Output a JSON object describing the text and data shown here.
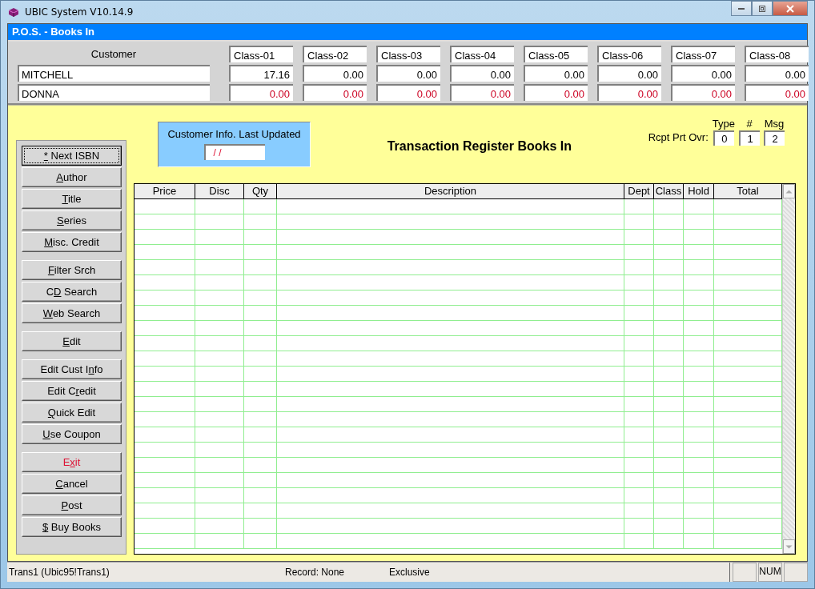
{
  "window": {
    "title": "UBIC System V10.14.9"
  },
  "form": {
    "title": "P.O.S. - Books In"
  },
  "customer": {
    "label": "Customer",
    "classes": [
      "Class-01",
      "Class-02",
      "Class-03",
      "Class-04",
      "Class-05",
      "Class-06",
      "Class-07",
      "Class-08"
    ],
    "rows": [
      {
        "name": "MITCHELL",
        "color": "#000000",
        "values": [
          "17.16",
          "0.00",
          "0.00",
          "0.00",
          "0.00",
          "0.00",
          "0.00",
          "0.00"
        ]
      },
      {
        "name": "DONNA",
        "color": "#cc0022",
        "values": [
          "0.00",
          "0.00",
          "0.00",
          "0.00",
          "0.00",
          "0.00",
          "0.00",
          "0.00"
        ]
      }
    ]
  },
  "info": {
    "label": "Customer Info. Last Updated",
    "value": "/ /"
  },
  "register_title": "Transaction Register Books In",
  "receipt": {
    "label": "Rcpt Prt Ovr:",
    "fields": [
      {
        "heading": "Type",
        "value": "0"
      },
      {
        "heading": "#",
        "value": "1"
      },
      {
        "heading": "Msg",
        "value": "2"
      }
    ]
  },
  "button_groups": [
    [
      {
        "key": "*",
        "post": " Next ISBN",
        "kind": "normal",
        "focused": true
      },
      {
        "key": "A",
        "post": "uthor",
        "kind": "normal",
        "focused": false
      },
      {
        "key": "T",
        "post": "itle",
        "kind": "normal",
        "focused": false
      },
      {
        "key": "S",
        "post": "eries",
        "kind": "normal",
        "focused": false
      },
      {
        "key": "M",
        "post": "isc. Credit",
        "kind": "normal",
        "focused": false
      }
    ],
    [
      {
        "key": "F",
        "post": "ilter Srch",
        "kind": "normal",
        "focused": false
      },
      {
        "pre": "C",
        "key": "D",
        "post": " Search",
        "kind": "normal",
        "focused": false
      },
      {
        "key": "W",
        "post": "eb Search",
        "kind": "normal",
        "focused": false
      }
    ],
    [
      {
        "key": "E",
        "post": "dit",
        "kind": "normal",
        "focused": false
      }
    ],
    [
      {
        "pre": "Edit Cust I",
        "key": "n",
        "post": "fo",
        "kind": "normal",
        "focused": false
      },
      {
        "pre": "Edit C",
        "key": "r",
        "post": "edit",
        "kind": "normal",
        "focused": false
      },
      {
        "key": "Q",
        "post": "uick Edit",
        "kind": "normal",
        "focused": false
      },
      {
        "key": "U",
        "post": "se Coupon",
        "kind": "normal",
        "focused": false
      }
    ],
    [
      {
        "pre": "E",
        "key": "x",
        "post": "it",
        "kind": "danger",
        "focused": false
      },
      {
        "key": "C",
        "post": "ancel",
        "kind": "normal",
        "focused": false
      },
      {
        "key": "P",
        "post": "ost",
        "kind": "normal",
        "focused": false
      },
      {
        "key": "$",
        "post": " Buy Books",
        "kind": "normal",
        "focused": false
      }
    ]
  ],
  "table": {
    "columns": [
      "Price",
      "Disc",
      "Qty",
      "Description",
      "Dept",
      "Class",
      "Hold",
      "Total"
    ]
  },
  "status_bar": {
    "table": "Trans1 (Ubic95!Trans1)",
    "record": "Record: None",
    "mode": "Exclusive",
    "num": "NUM"
  }
}
